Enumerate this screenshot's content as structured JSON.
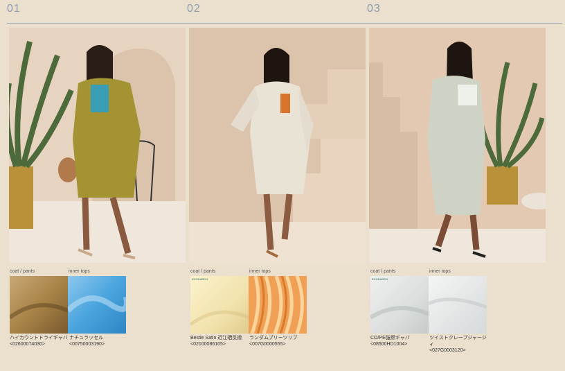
{
  "looks": [
    {
      "number": "01",
      "image_alt": "Model in olive trench coat with turquoise top, palm plant and arched wall",
      "caption_left": "coat / pants",
      "caption_right": "inner tops",
      "fabrics": [
        {
          "name": "ハイカウントドライギャバ",
          "code": "<02600074030>"
        },
        {
          "name": "ナチュラッセル",
          "code": "<00750003190>"
        }
      ]
    },
    {
      "number": "02",
      "image_alt": "Model in white oversized coat with orange top against beige staircase",
      "caption_left": "coat / pants",
      "caption_right": "inner tops",
      "fabrics": [
        {
          "name": "Bestie Satin 近江晒反撥",
          "code": "<02100086105>"
        },
        {
          "name": "ランダムプリーツリブ",
          "code": "<007G0000555>"
        }
      ]
    },
    {
      "number": "03",
      "image_alt": "Model in pale sage long coat and shorts beside staircase and potted plant",
      "caption_left": "coat / pants",
      "caption_right": "inner tops",
      "fabrics": [
        {
          "name": "CO/PE強撚ギャバ",
          "code": "<08500HD1004>"
        },
        {
          "name": "ツイストクレープジャージィ",
          "code": "<027G0003120>"
        }
      ]
    }
  ],
  "logos": {
    "ecosarch": "ECOSARCH"
  },
  "colors": {
    "background": "#ebe0cd",
    "number_color": "#8c9bb0",
    "olive_coat": "#a39332",
    "turquoise": "#3a9fb5",
    "white_coat": "#e9e3d6",
    "orange_top": "#d9742e",
    "sage_coat": "#cfd3c5"
  }
}
